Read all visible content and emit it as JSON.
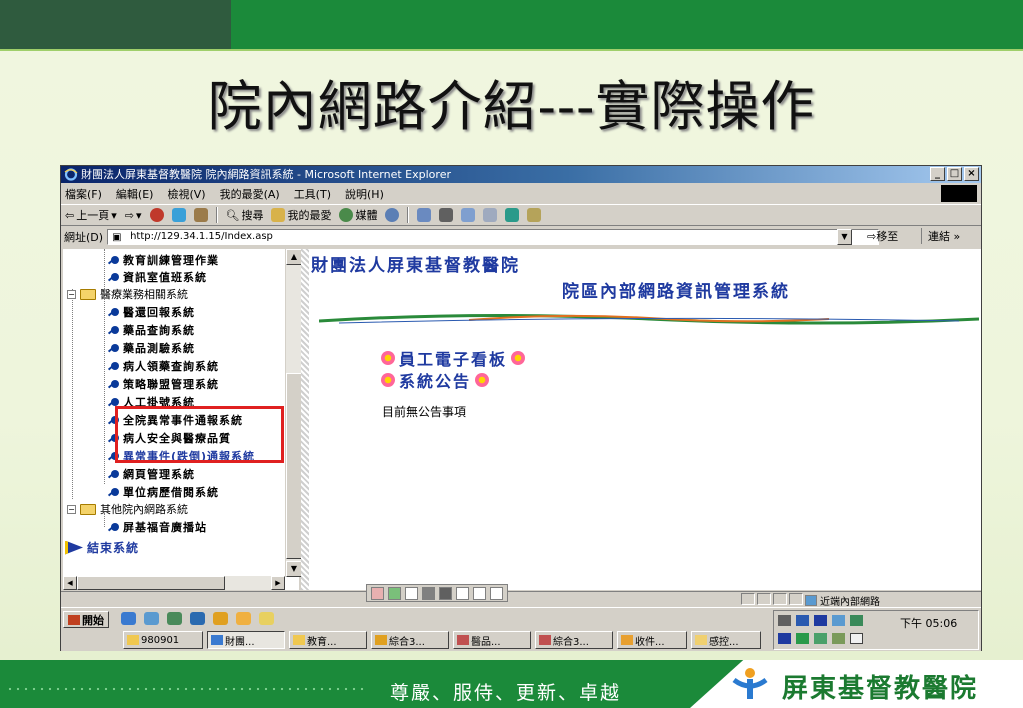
{
  "slide": {
    "title": "院內網路介紹---實際操作",
    "slogan": "尊嚴、服侍、更新、卓越",
    "hospital": "屏東基督教醫院"
  },
  "window": {
    "title": "財團法人屏東基督教醫院 院內網路資訊系統 - Microsoft Internet Explorer",
    "min": "_",
    "max": "□",
    "close": "×"
  },
  "menu": [
    "檔案(F)",
    "編輯(E)",
    "檢視(V)",
    "我的最愛(A)",
    "工具(T)",
    "說明(H)"
  ],
  "toolbar": {
    "back": "上一頁",
    "search": "搜尋",
    "favorites": "我的最愛",
    "media": "媒體"
  },
  "address": {
    "label": "網址(D)",
    "url": "http://129.34.1.15/Index.asp",
    "go": "移至",
    "links": "連結 »"
  },
  "tree": {
    "items": [
      "教育訓練管理作業",
      "資訊室值班系統",
      "醫療業務相關系統",
      "醫還回報系統",
      "藥品查詢系統",
      "藥品測驗系統",
      "病人領藥查詢系統",
      "策略聯盟管理系統",
      "人工掛號系統",
      "全院異常事件通報系統",
      "病人安全與醫療品質",
      "異常事件(跌倒)通報系統",
      "網頁管理系統",
      "單位病歷借閱系統",
      "其他院內網路系統",
      "屏基福音廣播站",
      "結束系統"
    ]
  },
  "content": {
    "hospital_name": "財團法人屏東基督教醫院",
    "system_name": "院區內部網路資訊管理系統",
    "link_board": "員工電子看板",
    "link_notice": "系統公告",
    "notice_text": "目前無公告事項"
  },
  "status": {
    "zone": "近端內部網路"
  },
  "taskbar": {
    "start": "開始",
    "time": "下午 05:06",
    "tasks": [
      "980901",
      "財團...",
      "教育...",
      "綜合3...",
      "醫品...",
      "綜合3...",
      "收件...",
      "感控..."
    ]
  },
  "colors": {
    "slide_green": "#1b8a3a",
    "content_blue": "#1f3aa0",
    "highlight_red": "#e02020"
  }
}
